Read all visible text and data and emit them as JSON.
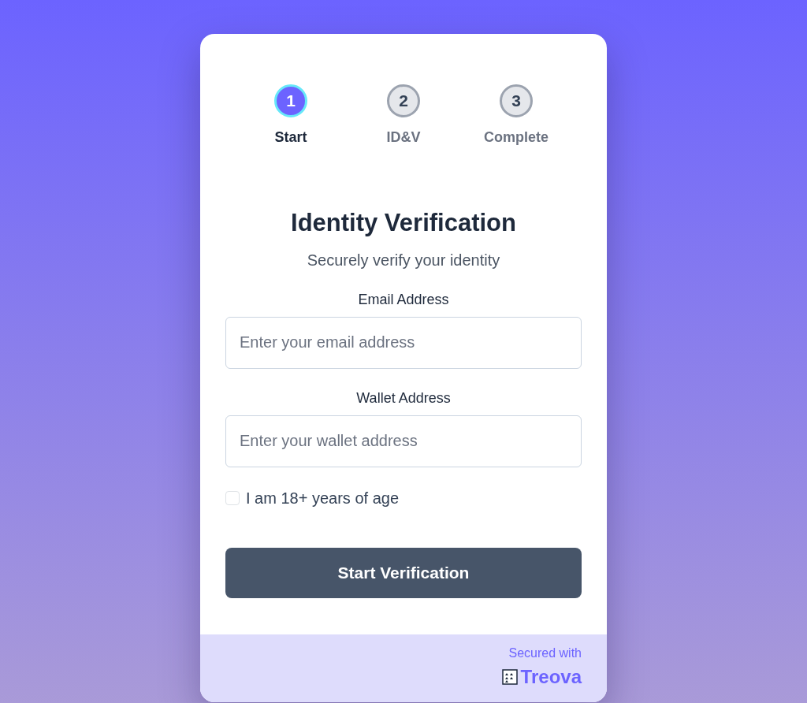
{
  "steps": [
    {
      "number": "1",
      "label": "Start",
      "selected": true
    },
    {
      "number": "2",
      "label": "ID&V",
      "selected": false
    },
    {
      "number": "3",
      "label": "Complete",
      "selected": false
    }
  ],
  "title": "Identity Verification",
  "subtitle": "Securely verify your identity",
  "fields": [
    {
      "label": "Email Address",
      "placeholder": "Enter your email address"
    },
    {
      "label": "Wallet Address",
      "placeholder": "Enter your wallet address"
    }
  ],
  "age_check": {
    "label": "I am 18+ years of age",
    "checked": false
  },
  "submit": "Start Verification",
  "footer": {
    "caption": "Secured with",
    "brand": "Treova"
  }
}
